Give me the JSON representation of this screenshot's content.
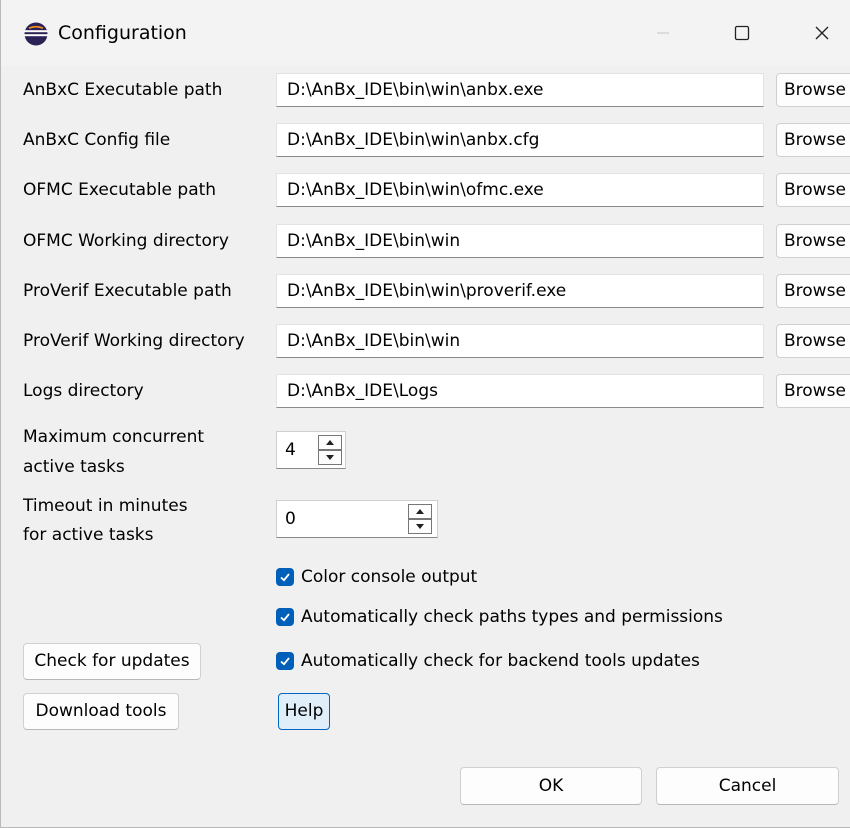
{
  "window": {
    "title": "Configuration",
    "controls": {
      "minimize_icon": "minimize-icon",
      "maximize_icon": "maximize-icon",
      "close_icon": "close-icon"
    }
  },
  "fields": [
    {
      "label": "AnBxC Executable path",
      "value": "D:\\AnBx_IDE\\bin\\win\\anbx.exe",
      "button": "Browse"
    },
    {
      "label": "AnBxC Config file",
      "value": "D:\\AnBx_IDE\\bin\\win\\anbx.cfg",
      "button": "Browse"
    },
    {
      "label": "OFMC Executable path",
      "value": "D:\\AnBx_IDE\\bin\\win\\ofmc.exe",
      "button": "Browse"
    },
    {
      "label": "OFMC Working directory",
      "value": "D:\\AnBx_IDE\\bin\\win",
      "button": "Browse"
    },
    {
      "label": "ProVerif Executable path",
      "value": "D:\\AnBx_IDE\\bin\\win\\proverif.exe",
      "button": "Browse"
    },
    {
      "label": "ProVerif Working directory",
      "value": "D:\\AnBx_IDE\\bin\\win",
      "button": "Browse"
    },
    {
      "label": "Logs directory",
      "value": "D:\\AnBx_IDE\\Logs",
      "button": "Browse"
    }
  ],
  "spinners": {
    "max_tasks": {
      "label_line1": "Maximum concurrent",
      "label_line2": "active tasks",
      "value": "4"
    },
    "timeout": {
      "label_line1": "Timeout in minutes",
      "label_line2": "for active tasks",
      "value": "0"
    }
  },
  "checkboxes": [
    {
      "label": "Color console output",
      "checked": true
    },
    {
      "label": "Automatically check paths types and permissions",
      "checked": true
    },
    {
      "label": "Automatically check for backend tools updates",
      "checked": true
    }
  ],
  "buttons": {
    "check_updates": "Check for updates",
    "download_tools": "Download tools",
    "help": "Help",
    "ok": "OK",
    "cancel": "Cancel"
  },
  "colors": {
    "accent": "#005fb8",
    "help_bg": "#e0eef9",
    "help_border": "#0067c0"
  }
}
